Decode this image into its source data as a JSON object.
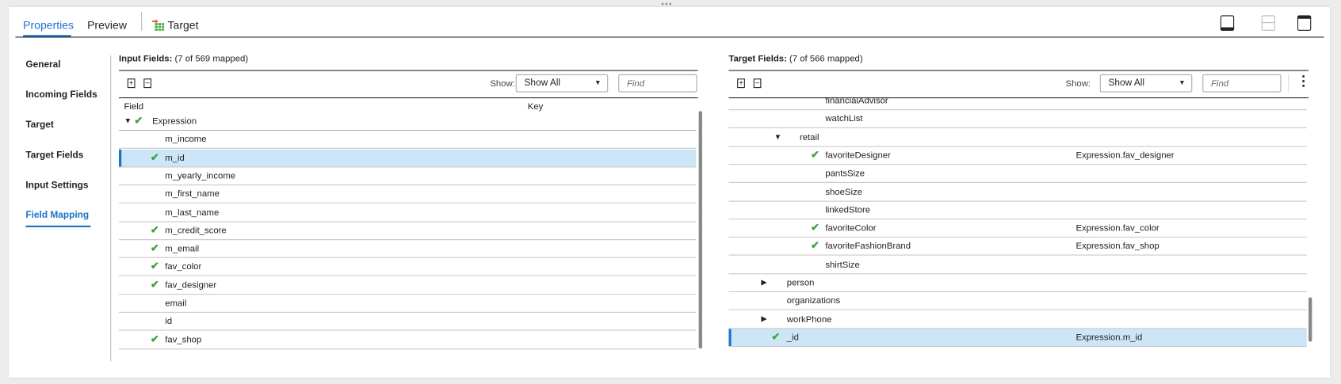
{
  "tabs": [
    {
      "label": "Properties",
      "active": true
    },
    {
      "label": "Preview"
    },
    {
      "label": "Target",
      "icon": "target-table-icon"
    }
  ],
  "layout_buttons": [
    "layout-bottom-icon",
    "layout-split-icon",
    "layout-top-icon"
  ],
  "nav": {
    "items": [
      {
        "label": "General"
      },
      {
        "label": "Incoming Fields"
      },
      {
        "label": "Target"
      },
      {
        "label": "Target Fields"
      },
      {
        "label": "Input Settings"
      },
      {
        "label": "Field Mapping",
        "active": true
      }
    ]
  },
  "input": {
    "title": "Input Fields:",
    "count": "(7 of 569 mapped)",
    "show_label": "Show:",
    "show_value": "Show All",
    "find_placeholder": "Find",
    "col_field": "Field",
    "col_key": "Key",
    "rows": [
      {
        "name": "Expression",
        "level": 0,
        "expand": "expanded",
        "mapped": true
      },
      {
        "name": "m_income",
        "level": 1,
        "mapped": false
      },
      {
        "name": "m_id",
        "level": 1,
        "mapped": true,
        "selected": true
      },
      {
        "name": "m_yearly_income",
        "level": 1,
        "mapped": false
      },
      {
        "name": "m_first_name",
        "level": 1,
        "mapped": false
      },
      {
        "name": "m_last_name",
        "level": 1,
        "mapped": false
      },
      {
        "name": "m_credit_score",
        "level": 1,
        "mapped": true
      },
      {
        "name": "m_email",
        "level": 1,
        "mapped": true
      },
      {
        "name": "fav_color",
        "level": 1,
        "mapped": true
      },
      {
        "name": "fav_designer",
        "level": 1,
        "mapped": true
      },
      {
        "name": "email",
        "level": 1,
        "mapped": false
      },
      {
        "name": "id",
        "level": 1,
        "mapped": false
      },
      {
        "name": "fav_shop",
        "level": 1,
        "mapped": true
      }
    ]
  },
  "target": {
    "title": "Target Fields:",
    "count": "(7 of 566 mapped)",
    "show_label": "Show:",
    "show_value": "Show All",
    "find_placeholder": "Find",
    "rows": [
      {
        "name": "financialAdvisor",
        "level": 3,
        "mapped": false,
        "partial": true
      },
      {
        "name": "watchList",
        "level": 3,
        "mapped": false
      },
      {
        "name": "retail",
        "level": 2,
        "expand": "expanded"
      },
      {
        "name": "favoriteDesigner",
        "level": 3,
        "mapped": true,
        "source": "Expression.fav_designer"
      },
      {
        "name": "pantsSize",
        "level": 3,
        "mapped": false
      },
      {
        "name": "shoeSize",
        "level": 3,
        "mapped": false
      },
      {
        "name": "linkedStore",
        "level": 3,
        "mapped": false
      },
      {
        "name": "favoriteColor",
        "level": 3,
        "mapped": true,
        "source": "Expression.fav_color"
      },
      {
        "name": "favoriteFashionBrand",
        "level": 3,
        "mapped": true,
        "source": "Expression.fav_shop"
      },
      {
        "name": "shirtSize",
        "level": 3,
        "mapped": false
      },
      {
        "name": "person",
        "level": 1,
        "expand": "collapsed"
      },
      {
        "name": "organizations",
        "level": 1,
        "mapped": false
      },
      {
        "name": "workPhone",
        "level": 1,
        "expand": "collapsed"
      },
      {
        "name": "_id",
        "level": 1,
        "mapped": true,
        "selected": true,
        "source": "Expression.m_id"
      }
    ]
  },
  "colors": {
    "accent": "#1a73c8",
    "selected_row": "#cde6f7",
    "check": "#3fa23f"
  }
}
